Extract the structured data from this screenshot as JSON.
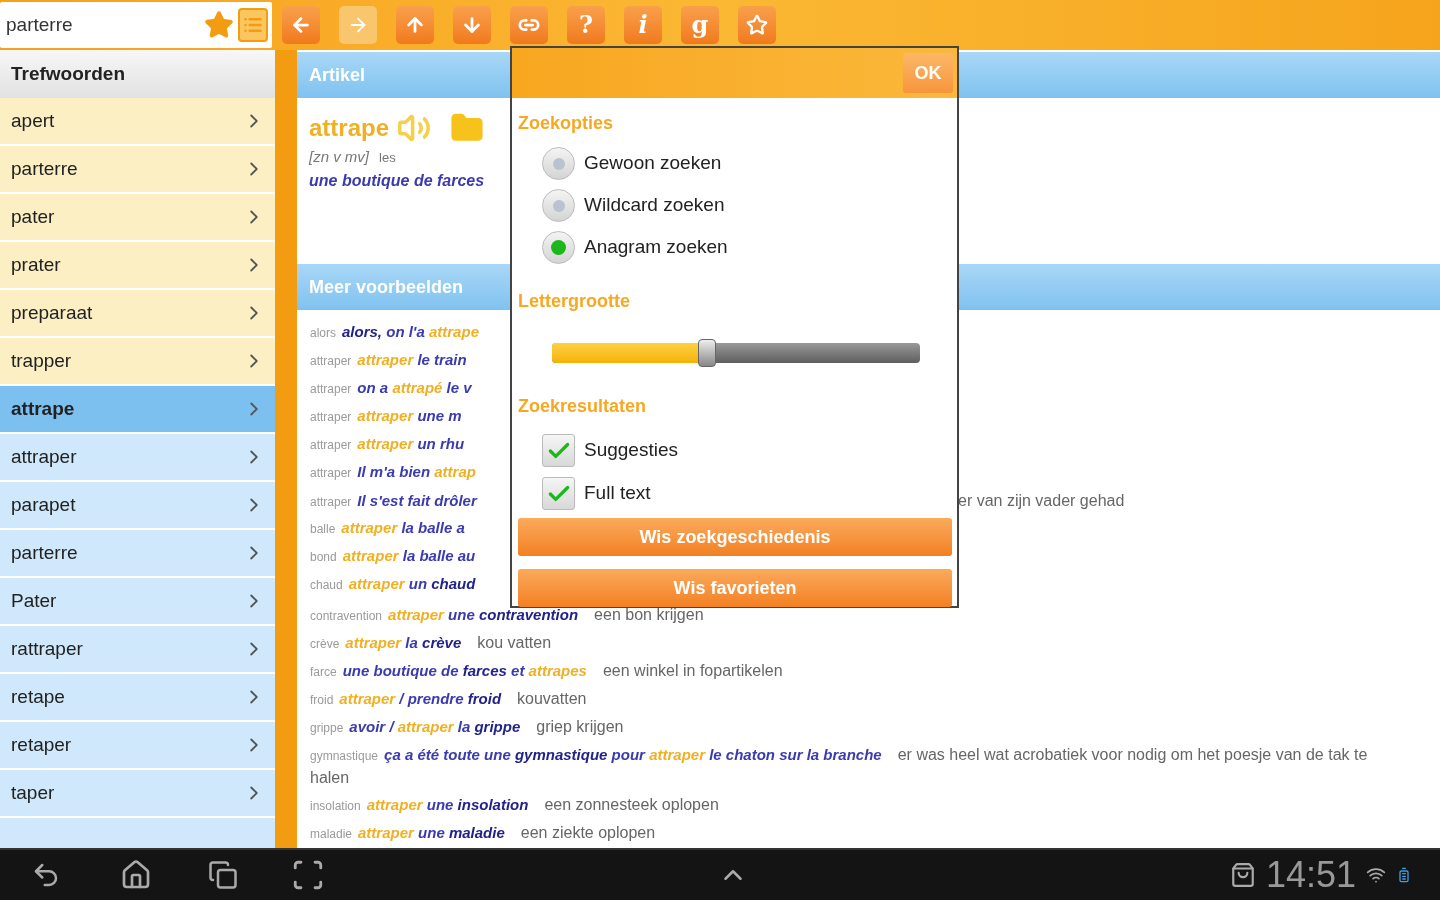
{
  "search": {
    "value": "parterre"
  },
  "toolbar": [
    {
      "kind": "back",
      "disabled": false
    },
    {
      "kind": "forward",
      "disabled": true
    },
    {
      "kind": "up",
      "disabled": false
    },
    {
      "kind": "down",
      "disabled": false
    },
    {
      "kind": "link",
      "disabled": false
    },
    {
      "kind": "text",
      "label": "?",
      "disabled": false
    },
    {
      "kind": "text",
      "label": "i",
      "disabled": false
    },
    {
      "kind": "text",
      "label": "g",
      "disabled": false
    },
    {
      "kind": "star",
      "disabled": false
    }
  ],
  "sidebar": {
    "title": "Trefwoorden",
    "items": [
      {
        "label": "apert",
        "color": "#fcefc4",
        "selected": false
      },
      {
        "label": "parterre",
        "color": "#fcefc4",
        "selected": false
      },
      {
        "label": "pater",
        "color": "#fcefc4",
        "selected": false
      },
      {
        "label": "prater",
        "color": "#fcefc4",
        "selected": false
      },
      {
        "label": "preparaat",
        "color": "#fcefc4",
        "selected": false
      },
      {
        "label": "trapper",
        "color": "#fcefc4",
        "selected": false
      },
      {
        "label": "attrape",
        "color": "#7cc0f0",
        "selected": true
      },
      {
        "label": "attraper",
        "color": "#cfe8fb",
        "selected": false
      },
      {
        "label": "parapet",
        "color": "#cfe8fb",
        "selected": false
      },
      {
        "label": "parterre",
        "color": "#cfe8fb",
        "selected": false
      },
      {
        "label": "Pater",
        "color": "#cfe8fb",
        "selected": false
      },
      {
        "label": "rattraper",
        "color": "#cfe8fb",
        "selected": false
      },
      {
        "label": "retape",
        "color": "#cfe8fb",
        "selected": false
      },
      {
        "label": "retaper",
        "color": "#cfe8fb",
        "selected": false
      },
      {
        "label": "taper",
        "color": "#cfe8fb",
        "selected": false
      }
    ]
  },
  "article": {
    "title": "Artikel",
    "headword": "attrape",
    "grammar": "[zn v mv]",
    "article_word": "les",
    "example": "une boutique de farces"
  },
  "examples": {
    "title": "Meer voorbeelden",
    "rows": [
      {
        "kind": "covered",
        "head": "alors",
        "parts": [
          {
            "kind": "em",
            "text": "alors,"
          },
          {
            "kind": "fr",
            "text": " on l'a "
          },
          {
            "kind": "key",
            "text": "attrape"
          }
        ]
      },
      {
        "kind": "covered",
        "head": "attraper",
        "parts": [
          {
            "kind": "key",
            "text": "attraper"
          },
          {
            "kind": "fr",
            "text": " le train"
          }
        ]
      },
      {
        "kind": "covered",
        "head": "attraper",
        "parts": [
          {
            "kind": "fr",
            "text": "on a "
          },
          {
            "kind": "key",
            "text": "attrapé"
          },
          {
            "kind": "fr",
            "text": " le v"
          }
        ]
      },
      {
        "kind": "covered",
        "head": "attraper",
        "parts": [
          {
            "kind": "key",
            "text": "attraper"
          },
          {
            "kind": "fr",
            "text": " une m"
          }
        ]
      },
      {
        "kind": "covered",
        "head": "attraper",
        "parts": [
          {
            "kind": "key",
            "text": "attraper"
          },
          {
            "kind": "fr",
            "text": " un rhu"
          }
        ]
      },
      {
        "kind": "covered",
        "head": "attraper",
        "parts": [
          {
            "kind": "fr",
            "text": "Il m'a bien "
          },
          {
            "kind": "key",
            "text": "attrap"
          }
        ]
      },
      {
        "kind": "covered",
        "head": "attraper",
        "parts": [
          {
            "kind": "fr",
            "text": "Il s'est fait drôler"
          }
        ],
        "translation": "er van zijn vader gehad"
      },
      {
        "kind": "covered",
        "head": "balle",
        "parts": [
          {
            "kind": "key",
            "text": "attraper"
          },
          {
            "kind": "fr",
            "text": " la balle a"
          }
        ]
      },
      {
        "kind": "covered",
        "head": "bond",
        "parts": [
          {
            "kind": "key",
            "text": "attraper"
          },
          {
            "kind": "fr",
            "text": " la balle au"
          }
        ]
      },
      {
        "kind": "covered",
        "head": "chaud",
        "parts": [
          {
            "kind": "key",
            "text": "attraper"
          },
          {
            "kind": "fr",
            "text": " un "
          },
          {
            "kind": "em",
            "text": "chaud"
          }
        ]
      },
      {
        "kind": "plain",
        "head": "contravention",
        "parts": [
          {
            "kind": "key",
            "text": "attraper"
          },
          {
            "kind": "fr",
            "text": " une "
          },
          {
            "kind": "em",
            "text": "contravention"
          }
        ],
        "translation": "een bon krijgen"
      },
      {
        "kind": "plain",
        "head": "crève",
        "parts": [
          {
            "kind": "key",
            "text": "attraper"
          },
          {
            "kind": "fr",
            "text": " la "
          },
          {
            "kind": "em",
            "text": "crève"
          }
        ],
        "translation": "kou vatten"
      },
      {
        "kind": "plain",
        "head": "farce",
        "parts": [
          {
            "kind": "fr",
            "text": "une boutique de "
          },
          {
            "kind": "em",
            "text": "farces"
          },
          {
            "kind": "fr",
            "text": " et "
          },
          {
            "kind": "key",
            "text": "attrapes"
          }
        ],
        "translation": "een winkel in fopartikelen"
      },
      {
        "kind": "plain",
        "head": "froid",
        "parts": [
          {
            "kind": "key",
            "text": "attraper"
          },
          {
            "kind": "fr",
            "text": " / prendre "
          },
          {
            "kind": "em",
            "text": "froid"
          }
        ],
        "translation": "kouvatten"
      },
      {
        "kind": "plain",
        "head": "grippe",
        "parts": [
          {
            "kind": "fr",
            "text": "avoir / "
          },
          {
            "kind": "key",
            "text": "attraper"
          },
          {
            "kind": "fr",
            "text": " la "
          },
          {
            "kind": "em",
            "text": "grippe"
          }
        ],
        "translation": "griep krijgen"
      },
      {
        "kind": "plain",
        "head": "gymnastique",
        "parts": [
          {
            "kind": "fr",
            "text": "ça a été toute une "
          },
          {
            "kind": "em",
            "text": "gymnastique"
          },
          {
            "kind": "fr",
            "text": " pour "
          },
          {
            "kind": "key",
            "text": "attraper"
          },
          {
            "kind": "fr",
            "text": " le chaton sur la branche"
          }
        ],
        "translation": "er was heel wat acrobatiek voor nodig om het poesje van de tak te halen"
      },
      {
        "kind": "plain",
        "head": "insolation",
        "parts": [
          {
            "kind": "key",
            "text": "attraper"
          },
          {
            "kind": "fr",
            "text": " une "
          },
          {
            "kind": "em",
            "text": "insolation"
          }
        ],
        "translation": "een zonnesteek oplopen"
      },
      {
        "kind": "plain",
        "head": "maladie",
        "parts": [
          {
            "kind": "key",
            "text": "attraper"
          },
          {
            "kind": "fr",
            "text": " une "
          },
          {
            "kind": "em",
            "text": "maladie"
          }
        ],
        "translation": "een ziekte oplopen"
      }
    ]
  },
  "dialog": {
    "ok": "OK",
    "search_title": "Zoekopties",
    "search_options": [
      {
        "label": "Gewoon zoeken",
        "selected": false
      },
      {
        "label": "Wildcard zoeken",
        "selected": false
      },
      {
        "label": "Anagram zoeken",
        "selected": true
      }
    ],
    "font_title": "Lettergrootte",
    "font_size": {
      "level": 0.42
    },
    "results_title": "Zoekresultaten",
    "result_options": [
      {
        "label": "Suggesties",
        "checked": true
      },
      {
        "label": "Full text",
        "checked": true
      }
    ],
    "buttons": [
      "Wis zoekgeschiedenis",
      "Wis favorieten"
    ]
  },
  "status_bar": {
    "time": "14:51"
  }
}
